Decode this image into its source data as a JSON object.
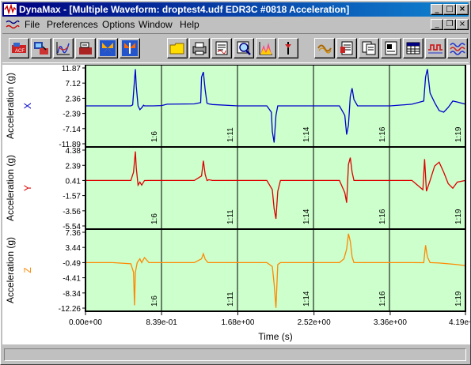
{
  "window": {
    "title": "DynaMax - [Multiple Waveform: droptest4.udf EDR3C #0818   Acceleration]",
    "caption_min": "_",
    "caption_max": "□",
    "caption_close": "×",
    "mdi_min": "_",
    "mdi_restore": "❐",
    "mdi_close": "×"
  },
  "menu": [
    {
      "label": "File"
    },
    {
      "label": "Preferences"
    },
    {
      "label": "Options"
    },
    {
      "label": "Window"
    },
    {
      "label": "Help"
    }
  ],
  "toolbar": [
    {
      "icon": "device-config-icon"
    },
    {
      "icon": "download-icon"
    },
    {
      "icon": "calibration-curve-icon"
    },
    {
      "icon": "transfer-icon"
    },
    {
      "icon": "butterfly-icon"
    },
    {
      "icon": "butterfly-alt-icon"
    },
    {
      "icon": "open-folder-icon"
    },
    {
      "icon": "print-icon"
    },
    {
      "icon": "report-icon"
    },
    {
      "icon": "zoom-plot-icon"
    },
    {
      "icon": "spectrum-icon"
    },
    {
      "icon": "marker-icon"
    },
    {
      "icon": "filter-icon"
    },
    {
      "icon": "notes-icon"
    },
    {
      "icon": "copy-pages-icon"
    },
    {
      "icon": "page-view-icon"
    },
    {
      "icon": "table-icon"
    },
    {
      "icon": "square-wave-icon"
    },
    {
      "icon": "multi-wave-icon"
    },
    {
      "icon": "multi-channel-icon"
    }
  ],
  "colors": {
    "plot_bg": "#ccffcc",
    "x": "#0000cc",
    "y": "#dd0000",
    "z": "#ff8800"
  },
  "chart_data": {
    "type": "line",
    "xlabel": "Time (s)",
    "x_ticks": [
      "0.00e+00",
      "8.39e-01",
      "1.68e+00",
      "2.52e+00",
      "3.36e+00",
      "4.19e+00"
    ],
    "x_tick_values": [
      0,
      0.839,
      1.68,
      2.52,
      3.36,
      4.19
    ],
    "xlim": [
      0,
      4.19
    ],
    "segment_labels": [
      "1:6",
      "1:11",
      "1:14",
      "1:16",
      "1:19"
    ],
    "panels": [
      {
        "channel": "X",
        "ylabel": "Acceleration (g)",
        "ylim": [
          -11.89,
          11.87
        ],
        "y_ticks": [
          "11.87",
          "7.12",
          "2.36",
          "-2.39",
          "-7.14",
          "-11.89"
        ],
        "y_tick_values": [
          11.87,
          7.12,
          2.36,
          -2.39,
          -7.14,
          -11.89
        ],
        "series": [
          {
            "x": [
              0,
              0.5,
              0.52,
              0.54,
              0.55,
              0.56,
              0.58,
              0.6,
              0.62,
              0.64,
              0.65,
              0.7,
              0.75,
              0.84,
              0.9,
              1.2,
              1.27,
              1.28,
              1.3,
              1.32,
              1.34,
              1.36,
              1.4,
              1.68,
              1.75,
              2.0,
              2.05,
              2.06,
              2.08,
              2.1,
              2.12,
              2.15,
              2.2,
              2.52,
              2.8,
              2.86,
              2.88,
              2.9,
              2.92,
              2.94,
              2.96,
              3.0,
              3.36,
              3.6,
              3.73,
              3.75,
              3.77,
              3.8,
              3.85,
              3.9,
              3.95,
              4.0,
              4.05,
              4.1,
              4.19
            ],
            "y": [
              0,
              0,
              0.3,
              8,
              11.5,
              6,
              0,
              -1.2,
              -0.6,
              0.2,
              0,
              0,
              0,
              0.1,
              0.5,
              0.6,
              1,
              9,
              10.6,
              5,
              0.8,
              0.6,
              0.4,
              0,
              0,
              0,
              -2,
              -8,
              -11.5,
              -3,
              0,
              0,
              0,
              0,
              0,
              -3,
              -9,
              -6,
              3,
              5.5,
              2,
              0,
              0,
              0.5,
              1.5,
              9,
              11.5,
              4,
              1,
              -1.5,
              -2,
              -0.5,
              1.5,
              1.2,
              0.5
            ]
          }
        ]
      },
      {
        "channel": "Y",
        "ylabel": "Acceleration (g)",
        "ylim": [
          -5.54,
          4.38
        ],
        "y_ticks": [
          "4.38",
          "2.39",
          "0.41",
          "-1.57",
          "-3.56",
          "-5.54"
        ],
        "y_tick_values": [
          4.38,
          2.39,
          0.41,
          -1.57,
          -3.56,
          -5.54
        ],
        "series": [
          {
            "x": [
              0,
              0.5,
              0.53,
              0.55,
              0.56,
              0.58,
              0.6,
              0.62,
              0.65,
              0.7,
              0.84,
              1.2,
              1.28,
              1.3,
              1.32,
              1.34,
              1.36,
              1.4,
              1.68,
              2.0,
              2.06,
              2.08,
              2.1,
              2.12,
              2.15,
              2.2,
              2.52,
              2.8,
              2.86,
              2.88,
              2.9,
              2.92,
              2.94,
              2.96,
              3.0,
              3.36,
              3.6,
              3.72,
              3.74,
              3.76,
              3.8,
              3.85,
              3.9,
              3.95,
              4.0,
              4.05,
              4.1,
              4.19
            ],
            "y": [
              0.41,
              0.41,
              1.5,
              4.2,
              2,
              -0.2,
              0.2,
              -0.2,
              0.4,
              0.41,
              0.41,
              0.41,
              1,
              3,
              1.2,
              0.4,
              0.5,
              0.41,
              0.41,
              0.41,
              -0.8,
              -3.3,
              -4.6,
              -1,
              0.41,
              0.41,
              0.41,
              0.41,
              -1.2,
              -2.5,
              2.5,
              3.4,
              1.5,
              0.41,
              0.41,
              0.41,
              0.41,
              -0.8,
              3.2,
              -1,
              0.41,
              2.3,
              2.8,
              1.5,
              0,
              -0.6,
              0.2,
              0.41
            ]
          }
        ]
      },
      {
        "channel": "Z",
        "ylabel": "Acceleration (g)",
        "ylim": [
          -12.26,
          7.36
        ],
        "y_ticks": [
          "7.36",
          "3.44",
          "-0.49",
          "-4.41",
          "-8.34",
          "-12.26"
        ],
        "y_tick_values": [
          7.36,
          3.44,
          -0.49,
          -4.41,
          -8.34,
          -12.26
        ],
        "series": [
          {
            "x": [
              0,
              0.3,
              0.5,
              0.53,
              0.54,
              0.55,
              0.57,
              0.6,
              0.62,
              0.65,
              0.7,
              0.84,
              1.2,
              1.28,
              1.3,
              1.32,
              1.35,
              1.4,
              1.68,
              2.0,
              2.06,
              2.08,
              2.1,
              2.12,
              2.15,
              2.2,
              2.52,
              2.8,
              2.85,
              2.88,
              2.9,
              2.92,
              2.94,
              2.96,
              3.0,
              3.36,
              3.6,
              3.73,
              3.75,
              3.77,
              3.8,
              3.9,
              4.0,
              4.1,
              4.19
            ],
            "y": [
              -0.49,
              -0.49,
              -0.8,
              -3,
              -11.5,
              -3,
              -0.5,
              0.5,
              -0.5,
              0.8,
              -0.49,
              -0.49,
              -0.49,
              0.5,
              1.8,
              0.4,
              -0.49,
              -0.49,
              -0.49,
              -0.49,
              -1.5,
              -6,
              -12.2,
              -1,
              -0.49,
              -0.49,
              -0.49,
              -0.49,
              0.5,
              3,
              7,
              5,
              1,
              -0.49,
              -0.49,
              -0.49,
              -0.49,
              -0.5,
              4,
              1,
              -0.49,
              -0.6,
              -0.8,
              -1,
              -1.3
            ]
          }
        ]
      }
    ]
  }
}
